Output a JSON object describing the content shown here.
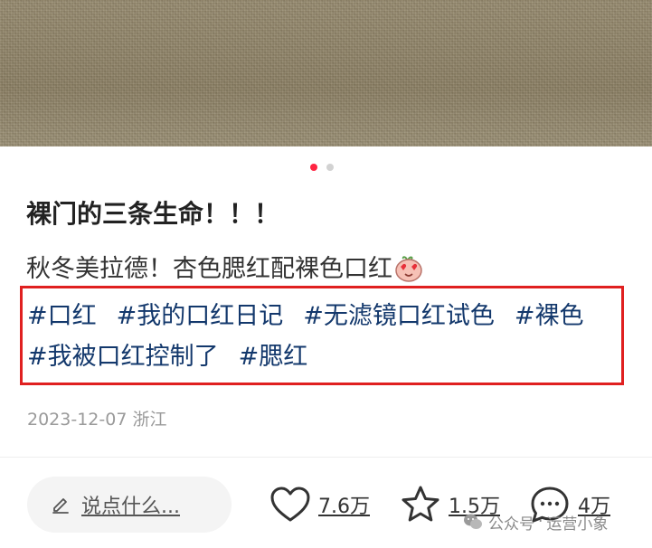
{
  "post": {
    "title": "裸门的三条生命！！！",
    "description": "秋冬美拉德！杏色腮红配裸色口红",
    "tags_line1": [
      "#口红",
      "#我的口红日记",
      "#无滤镜口红试色",
      "#裸色"
    ],
    "tags_line2": [
      "#我被口红控制了",
      "#腮红"
    ],
    "date_location": "2023-12-07 浙江"
  },
  "carousel": {
    "total": 2,
    "active_index": 0
  },
  "bottom_bar": {
    "comment_placeholder": "说点什么...",
    "likes": "7.6万",
    "collects": "1.5万",
    "comments": "4万"
  },
  "watermark": {
    "platform": "公众号",
    "account": "运营小象"
  },
  "colors": {
    "accent": "#ff2442",
    "tag": "#13386c",
    "highlight_box": "#e02020",
    "muted": "#9a9a9a"
  },
  "icons": [
    "pencil-icon",
    "heart-icon",
    "star-icon",
    "comment-bubble-icon",
    "emoji-face-icon",
    "wechat-icon"
  ]
}
